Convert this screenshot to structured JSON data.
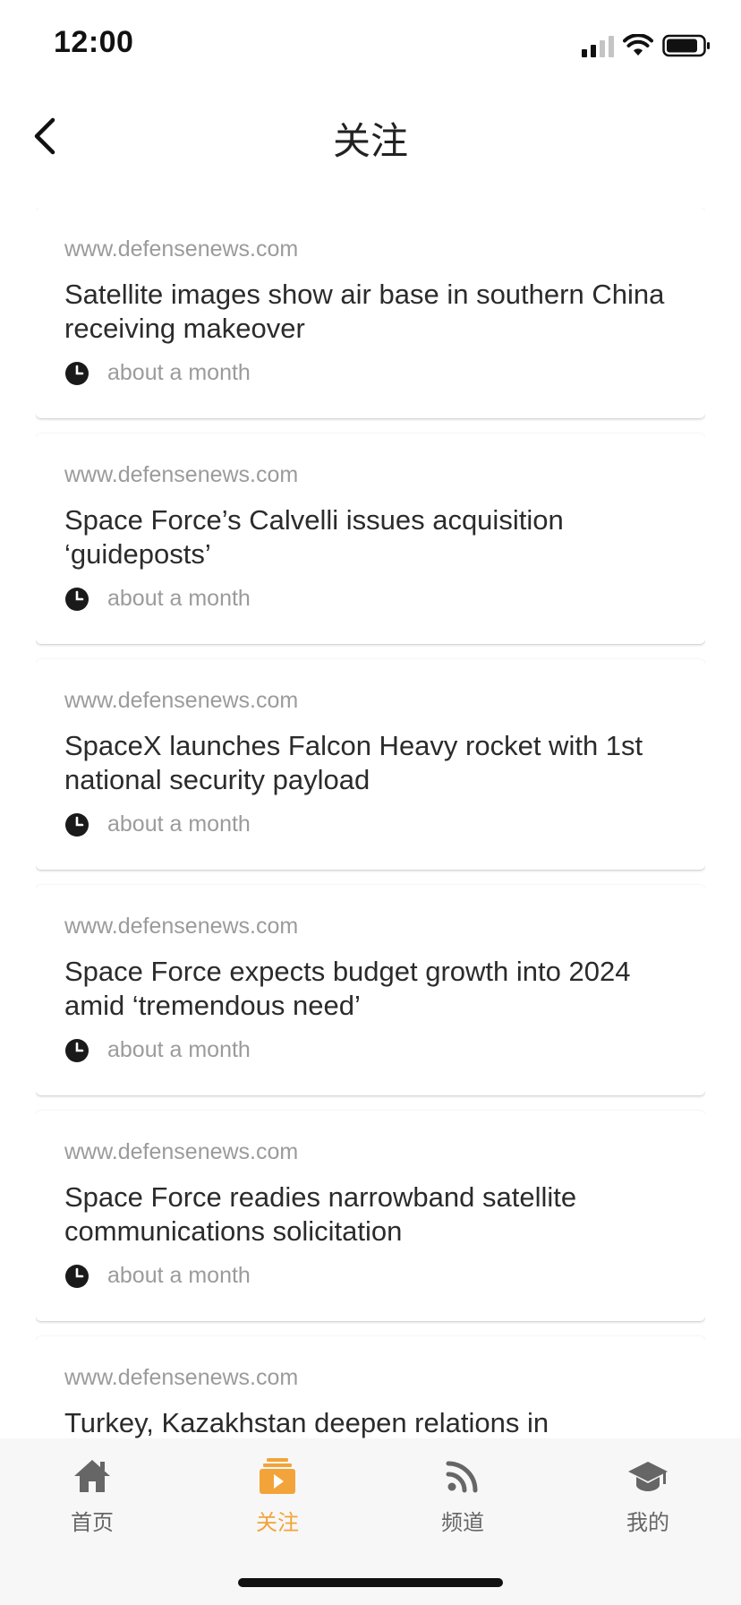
{
  "status_bar": {
    "time": "12:00"
  },
  "header": {
    "title": "关注",
    "back_icon": "chevron-left-icon"
  },
  "articles": [
    {
      "source": "www.defensenews.com",
      "title": "Satellite images show air base in southern China receiving makeover",
      "time": "about a month"
    },
    {
      "source": "www.defensenews.com",
      "title": "Space Force’s Calvelli issues acquisition ‘guideposts’",
      "time": "about a month"
    },
    {
      "source": "www.defensenews.com",
      "title": "SpaceX launches Falcon Heavy rocket with 1st national security payload",
      "time": "about a month"
    },
    {
      "source": "www.defensenews.com",
      "title": "Space Force expects budget growth into 2024 amid ‘tremendous need’",
      "time": "about a month"
    },
    {
      "source": "www.defensenews.com",
      "title": "Space Force readies narrowband satellite communications solicitation",
      "time": "about a month"
    },
    {
      "source": "www.defensenews.com",
      "title": "Turkey, Kazakhstan deepen relations in",
      "time": ""
    }
  ],
  "bottom_nav": {
    "items": [
      {
        "label": "首页",
        "icon": "home-icon",
        "active": false
      },
      {
        "label": "关注",
        "icon": "play-stack-icon",
        "active": true
      },
      {
        "label": "频道",
        "icon": "rss-icon",
        "active": false
      },
      {
        "label": "我的",
        "icon": "graduation-cap-icon",
        "active": false
      }
    ]
  },
  "colors": {
    "accent": "#f2a43a",
    "inactive": "#666666",
    "muted_text": "#9b9b9b"
  }
}
